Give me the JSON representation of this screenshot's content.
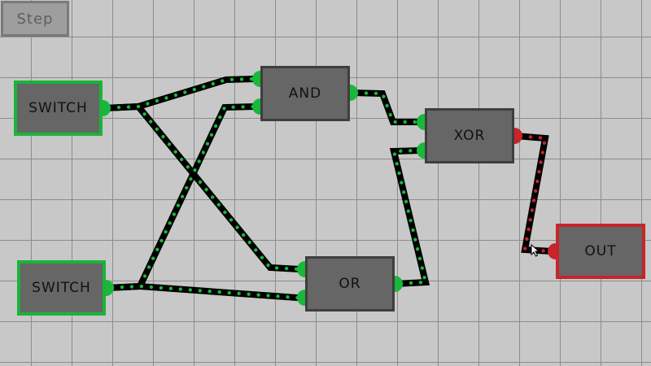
{
  "toolbar": {
    "step_label": "Step"
  },
  "gates": {
    "switch_top": {
      "label": "SWITCH"
    },
    "switch_bottom": {
      "label": "SWITCH"
    },
    "and": {
      "label": "AND"
    },
    "or": {
      "label": "OR"
    },
    "xor": {
      "label": "XOR"
    },
    "out": {
      "label": "OUT"
    }
  },
  "colors": {
    "wire": "#000000",
    "signal_on": "#18b83a",
    "signal_off": "#c8242a",
    "gate_fill": "#666666",
    "gate_border": "#3e3e3e",
    "switch_border": "#1bb33a",
    "output_border": "#c8242a",
    "grid_line": "#8c8c8c",
    "background": "#c8c8c8"
  }
}
